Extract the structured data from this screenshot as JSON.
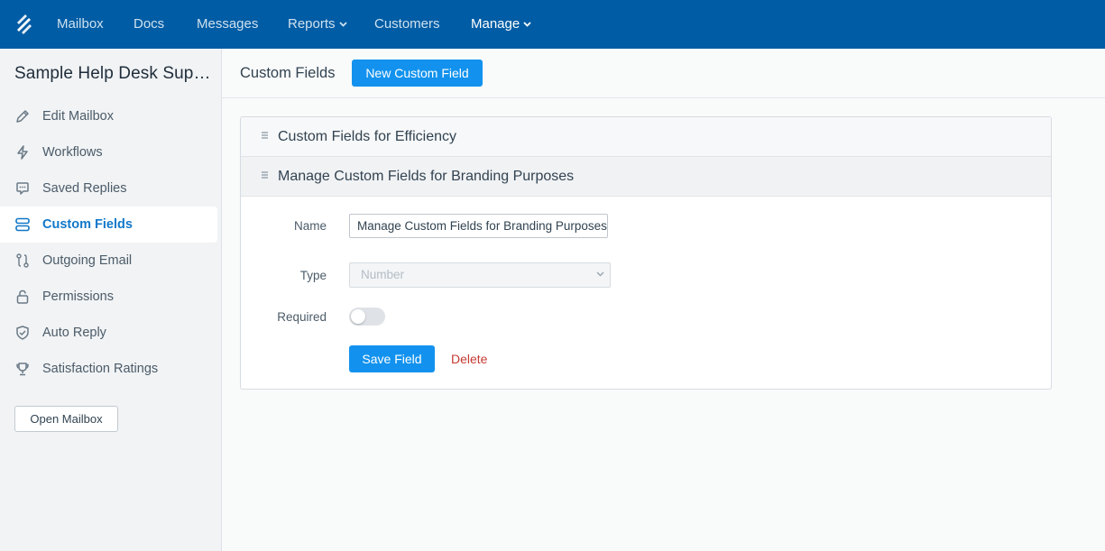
{
  "topnav": {
    "items": [
      {
        "label": "Mailbox"
      },
      {
        "label": "Docs"
      },
      {
        "label": "Messages"
      },
      {
        "label": "Reports",
        "has_dropdown": true
      },
      {
        "label": "Customers"
      },
      {
        "label": "Manage",
        "has_dropdown": true,
        "active": true
      }
    ],
    "logo_icon": "helpscout-logo-icon",
    "background": "#005ca4"
  },
  "sidebar": {
    "title": "Sample Help Desk Supp…",
    "items": [
      {
        "label": "Edit Mailbox",
        "icon": "pencil-icon"
      },
      {
        "label": "Workflows",
        "icon": "lightning-icon"
      },
      {
        "label": "Saved Replies",
        "icon": "chat-bubble-icon"
      },
      {
        "label": "Custom Fields",
        "icon": "fields-icon",
        "active": true
      },
      {
        "label": "Outgoing Email",
        "icon": "route-icon"
      },
      {
        "label": "Permissions",
        "icon": "lock-icon"
      },
      {
        "label": "Auto Reply",
        "icon": "shield-check-icon"
      },
      {
        "label": "Satisfaction Ratings",
        "icon": "trophy-icon"
      }
    ],
    "open_button": "Open Mailbox"
  },
  "main": {
    "title": "Custom Fields",
    "new_button": "New Custom Field",
    "rows": [
      {
        "title": "Custom Fields for Efficiency",
        "expanded": false
      },
      {
        "title": "Manage Custom Fields for Branding Purposes",
        "expanded": true
      }
    ],
    "form": {
      "name_label": "Name",
      "name_value": "Manage Custom Fields for Branding Purposes",
      "type_label": "Type",
      "type_value": "Number",
      "required_label": "Required",
      "required": false,
      "save_button": "Save Field",
      "delete_link": "Delete"
    }
  },
  "colors": {
    "accent": "#1292ee",
    "active_link": "#1178c9",
    "danger": "#c43b33"
  }
}
